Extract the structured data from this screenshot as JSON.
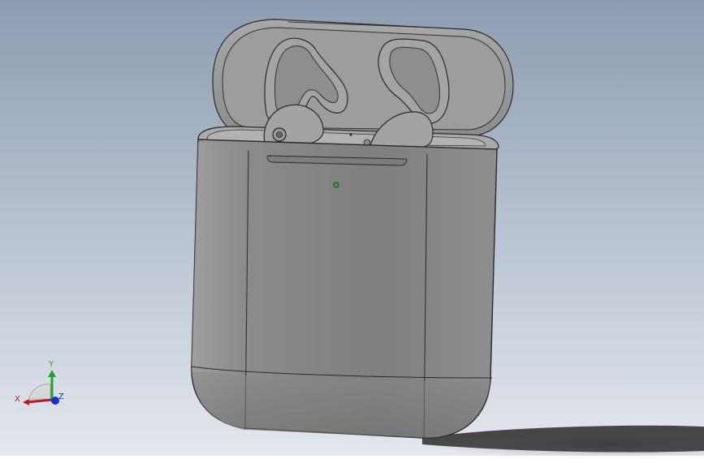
{
  "viewport": {
    "background_top": "#8c9cb2",
    "background_bottom": "#e4e8ee",
    "model_color": "#8a8a8a",
    "model_edge_color": "#2a2a2a",
    "led_color": "#3aa83a"
  },
  "triad": {
    "x_label": "X",
    "y_label": "Y",
    "z_label": "Z",
    "x_color": "#c0171d",
    "y_color": "#27a02c",
    "z_color": "#1a2fd0"
  }
}
